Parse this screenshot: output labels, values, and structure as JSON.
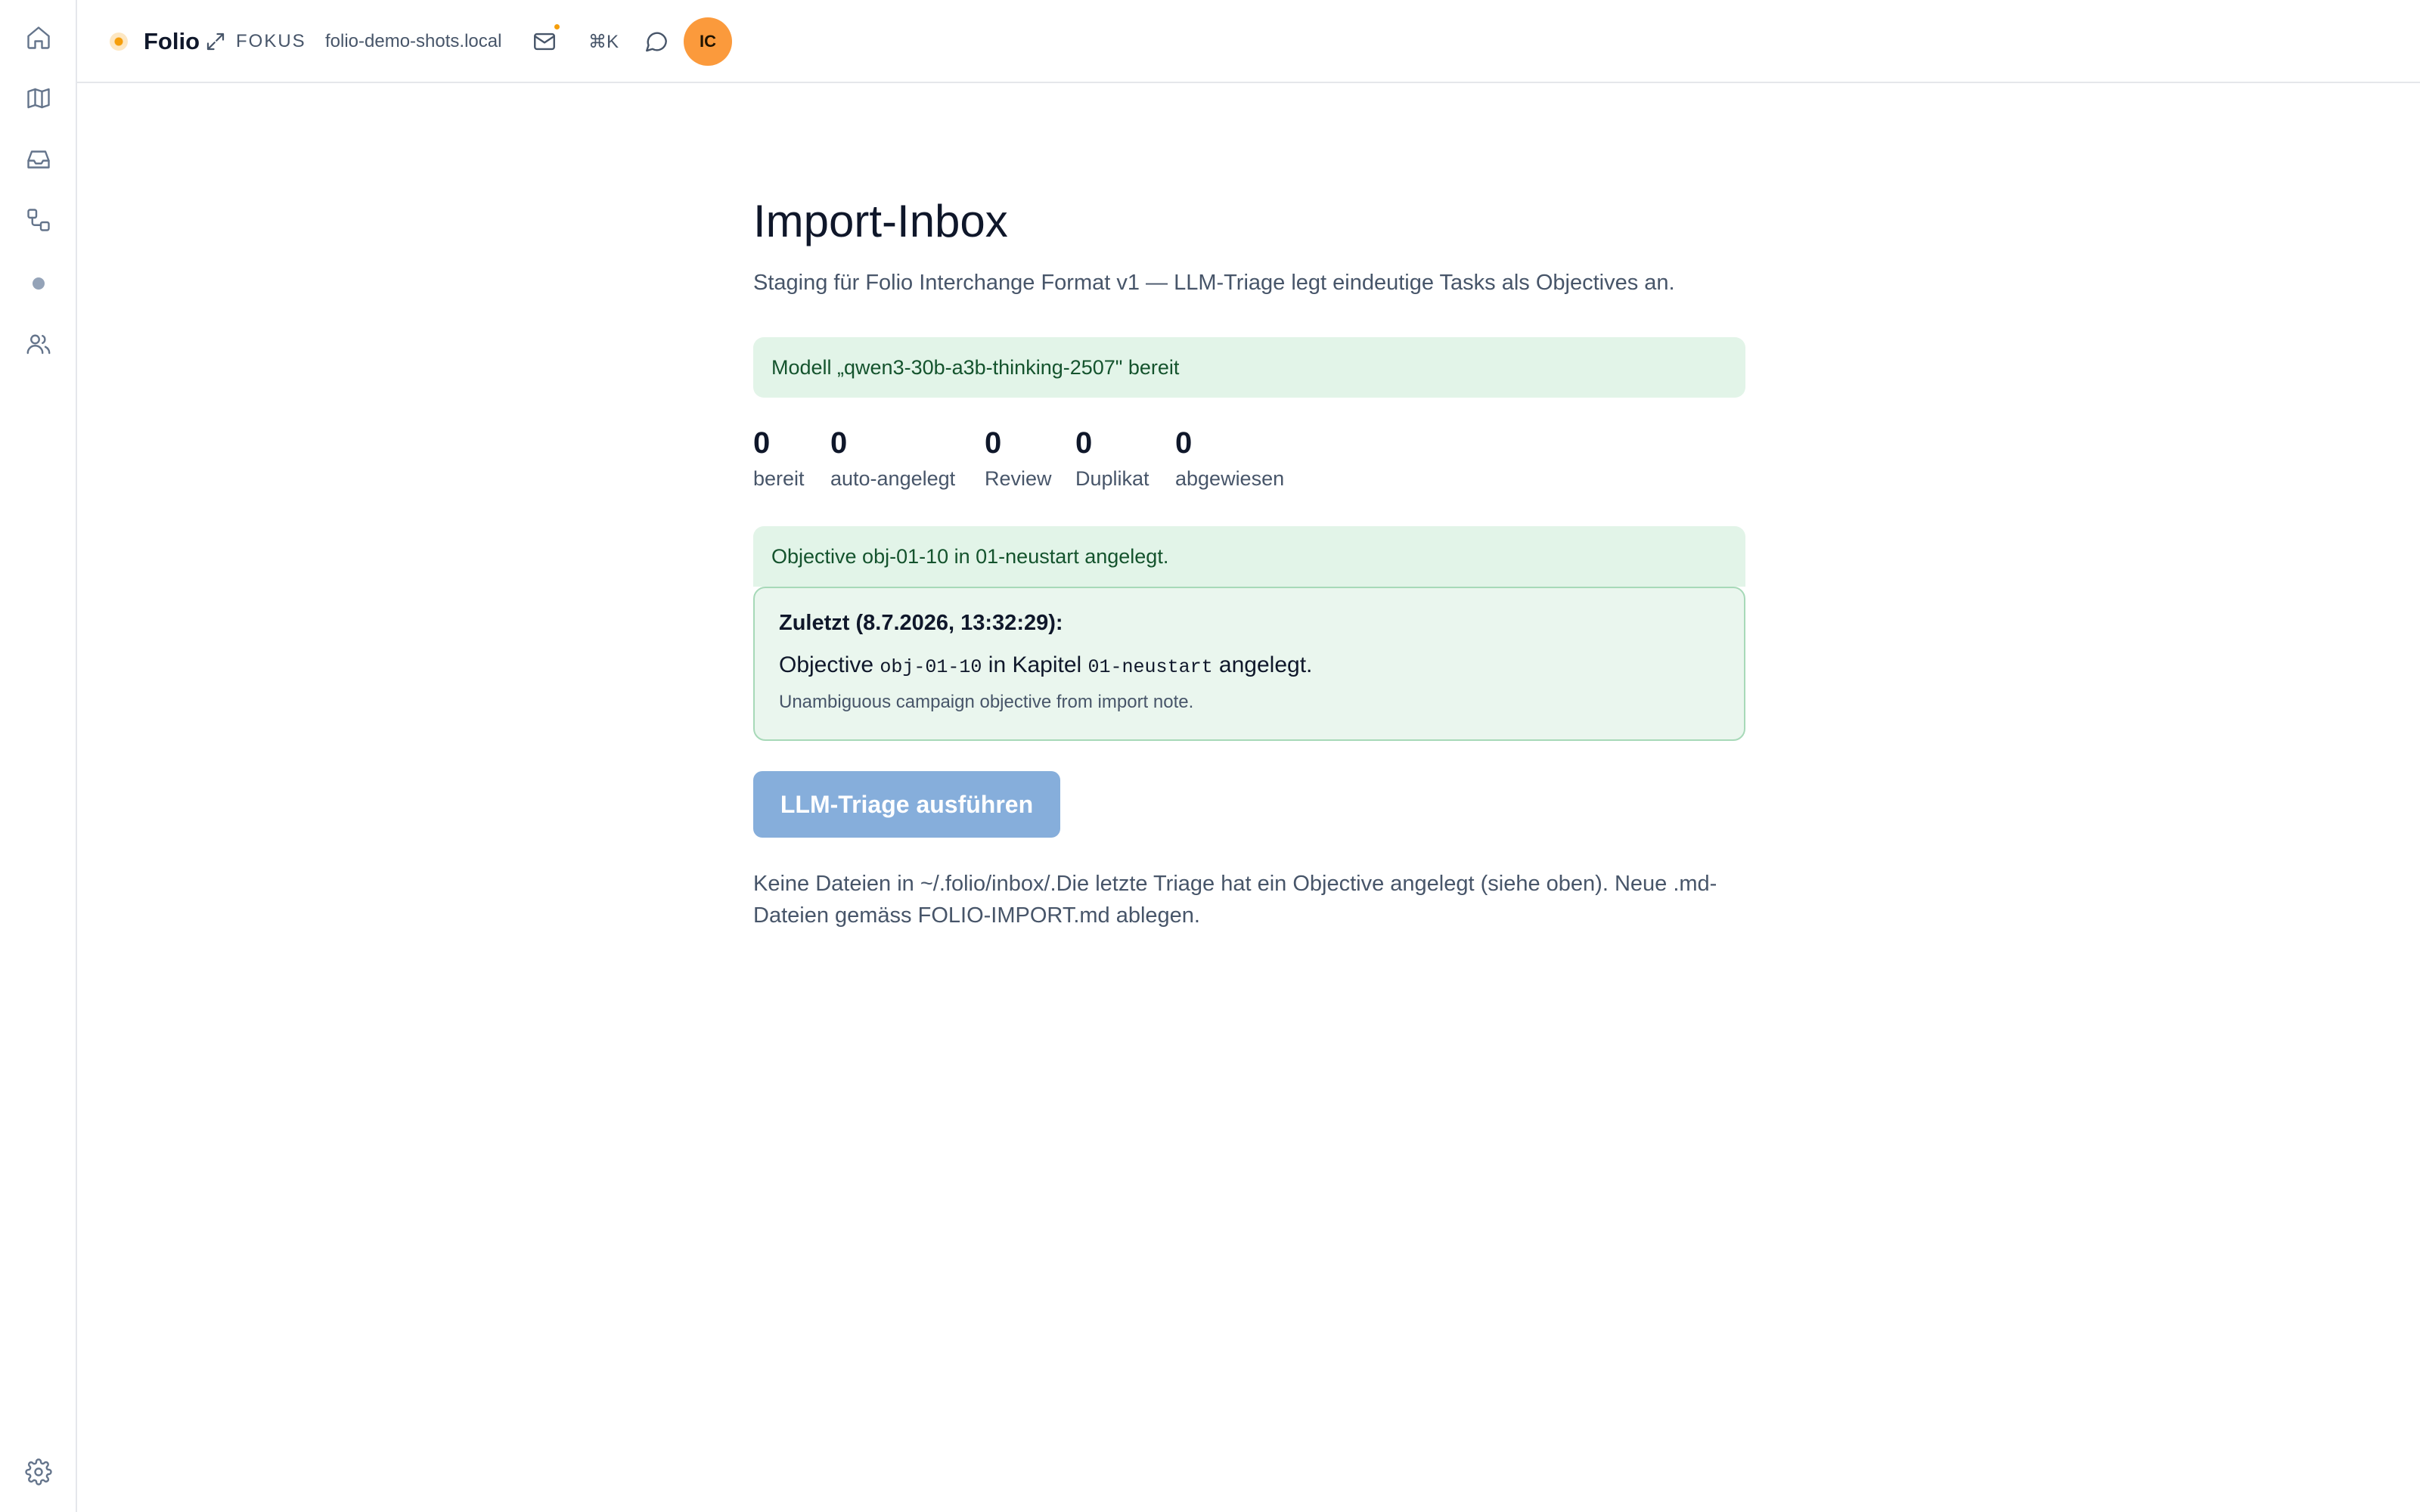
{
  "topbar": {
    "brand": "Folio",
    "focus_label": "FOKUS",
    "host": "folio-demo-shots.local",
    "cmdk_label": "⌘K",
    "avatar_initials": "IC"
  },
  "rail": {
    "items": [
      "home-icon",
      "map-icon",
      "inbox-icon",
      "workflow-icon",
      "dot",
      "users-icon"
    ],
    "bottom": "gear-icon"
  },
  "page": {
    "title": "Import-Inbox",
    "subtitle": "Staging für Folio Interchange Format v1 — LLM-Triage legt eindeutige Tasks als Objectives an."
  },
  "model_banner": "Modell „qwen3-30b-a3b-thinking-2507\" bereit",
  "stats": [
    {
      "value": "0",
      "label": "bereit"
    },
    {
      "value": "0",
      "label": "auto-angelegt"
    },
    {
      "value": "0",
      "label": "Review"
    },
    {
      "value": "0",
      "label": "Duplikat"
    },
    {
      "value": "0",
      "label": "abgewiesen"
    }
  ],
  "notice": "Objective obj-01-10 in 01-neustart angelegt.",
  "last": {
    "heading": "Zuletzt (8.7.2026, 13:32:29):",
    "prefix": "Objective",
    "objective_id": "obj-01-10",
    "middle": "in Kapitel",
    "chapter_id": "01-neustart",
    "suffix": "angelegt.",
    "note": "Unambiguous campaign objective from import note."
  },
  "run_button": "LLM-Triage ausführen",
  "empty_message": "Keine Dateien in ~/.folio/inbox/.Die letzte Triage hat ein Objective angelegt (siehe oben). Neue .md-Dateien gemäss FOLIO-IMPORT.md ablegen.",
  "colors": {
    "accent_avatar": "#fb9a3c",
    "success_bg": "#e2f4e8",
    "button_disabled": "#86aedb"
  }
}
